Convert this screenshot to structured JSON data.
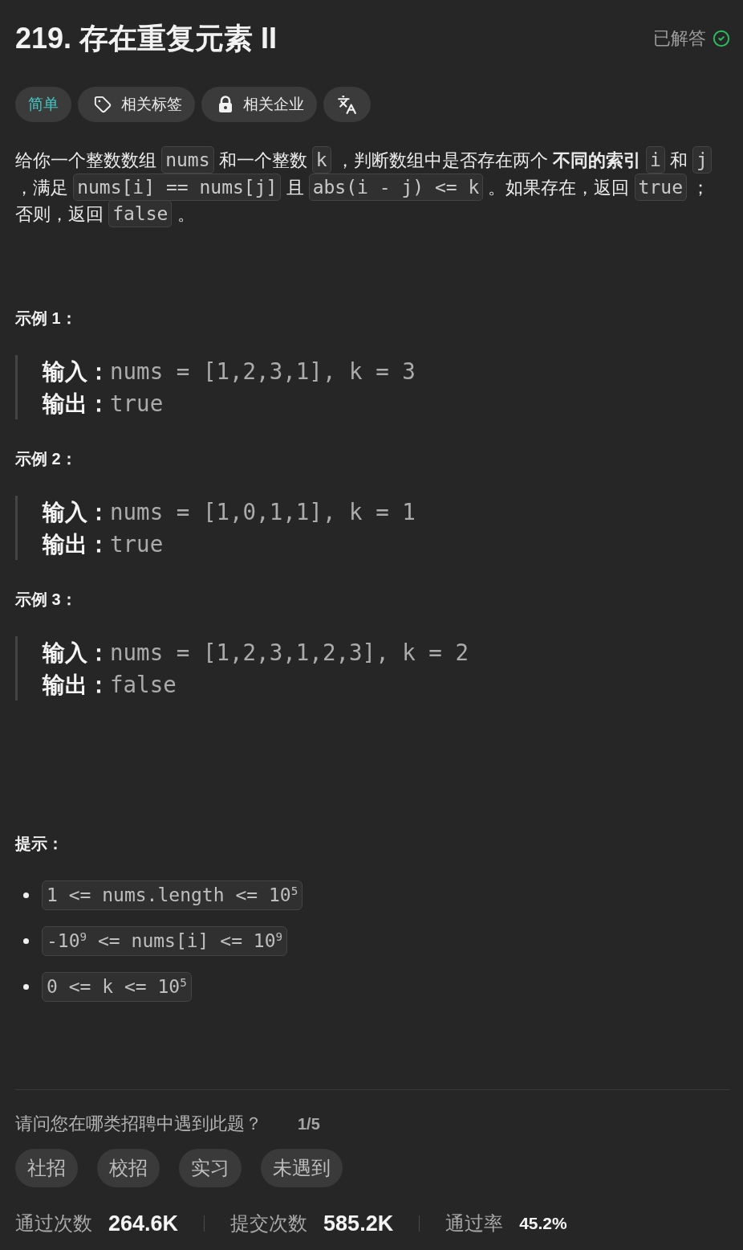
{
  "problem": {
    "title": "219. 存在重复元素 II",
    "status": {
      "label": "已解答",
      "solved": true
    }
  },
  "tags": [
    {
      "kind": "difficulty",
      "label": "简单"
    },
    {
      "kind": "topics",
      "label": "相关标签"
    },
    {
      "kind": "companies",
      "label": "相关企业"
    },
    {
      "kind": "translate"
    }
  ],
  "description": [
    {
      "kind": "text",
      "text": "给你一个整数数组"
    },
    {
      "kind": "code",
      "text": "nums"
    },
    {
      "kind": "text",
      "text": "和一个整数"
    },
    {
      "kind": "code",
      "text": "k"
    },
    {
      "kind": "text",
      "text": "，判断数组中是否存在两个 **不同的索引**"
    },
    {
      "kind": "code",
      "text": "i"
    },
    {
      "kind": "text",
      "text": "和"
    },
    {
      "kind": "code",
      "text": "j"
    },
    {
      "kind": "text",
      "text": "，满足"
    },
    {
      "kind": "code",
      "text": "nums[i] == nums[j]"
    },
    {
      "kind": "text",
      "text": "且"
    },
    {
      "kind": "code",
      "text": "abs(i - j) <= k"
    },
    {
      "kind": "text",
      "text": "。如果存在，返回"
    },
    {
      "kind": "code",
      "text": "true"
    },
    {
      "kind": "text",
      "text": "；"
    },
    {
      "kind": "text",
      "text": "否则，返回"
    },
    {
      "kind": "code",
      "text": "false"
    },
    {
      "kind": "text",
      "text": "。"
    }
  ],
  "examples": [
    {
      "heading": "示例 1：",
      "lines": [
        {
          "label": "输入：",
          "value": "nums = [1,2,3,1], k = 3"
        },
        {
          "label": "输出：",
          "value": "true"
        }
      ]
    },
    {
      "heading": "示例 2：",
      "lines": [
        {
          "label": "输入：",
          "value": "nums = [1,0,1,1], k = 1"
        },
        {
          "label": "输出：",
          "value": "true"
        }
      ]
    },
    {
      "heading": "示例 3：",
      "lines": [
        {
          "label": "输入：",
          "value": "nums = [1,2,3,1,2,3], k = 2"
        },
        {
          "label": "输出：",
          "value": "false"
        }
      ]
    }
  ],
  "constraints": {
    "heading": "提示：",
    "items": [
      "1 <= nums.length <= 10$^{5}$",
      "-10$^{9}$ <= nums[i] <= 10$^{9}$",
      "0 <= k <= 10$^{5}$"
    ]
  },
  "survey": {
    "question": "请问您在哪类招聘中遇到此题？",
    "counter": "1/5",
    "options": [
      {
        "label": "社招",
        "selected": false
      },
      {
        "label": "校招",
        "selected": false
      },
      {
        "label": "实习",
        "selected": false
      },
      {
        "label": "未遇到",
        "selected": false
      }
    ]
  },
  "stats": [
    {
      "kind": "count",
      "label": "通过次数",
      "value": "264.6K"
    },
    {
      "kind": "count",
      "label": "提交次数",
      "value": "585.2K"
    },
    {
      "kind": "rate",
      "label": "通过率",
      "value": "45.2%"
    }
  ]
}
